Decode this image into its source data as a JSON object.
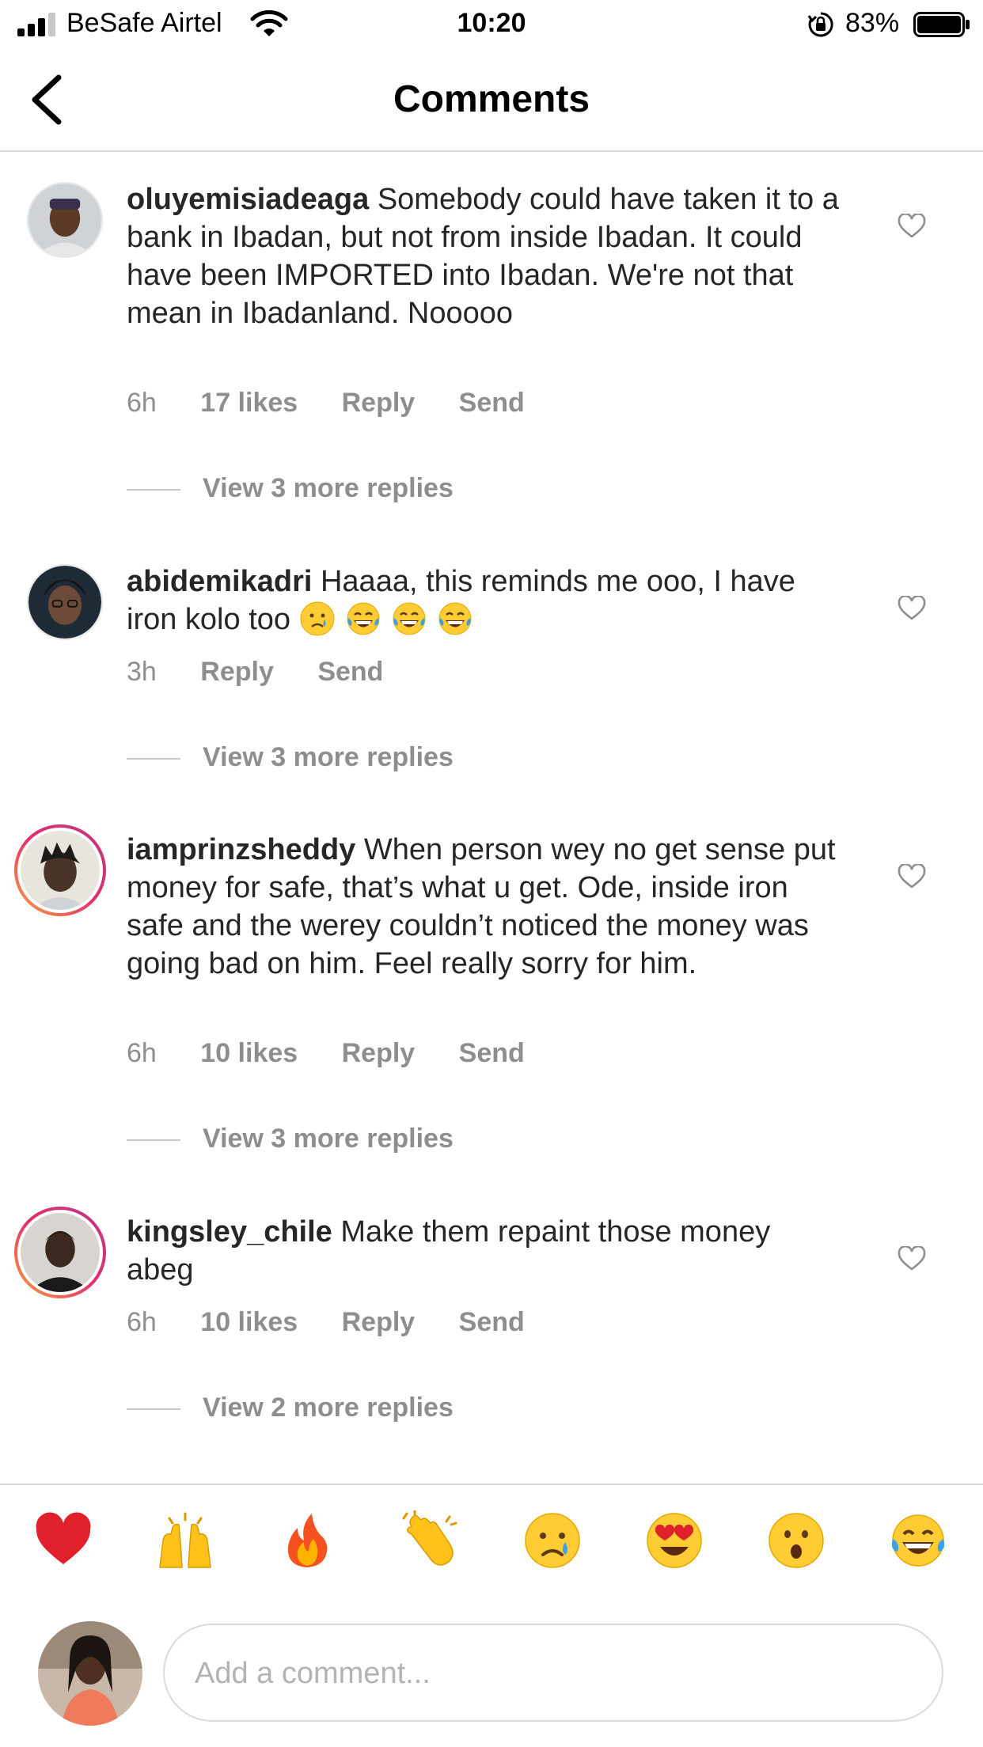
{
  "status_bar": {
    "carrier": "BeSafe Airtel",
    "time": "10:20",
    "battery_percent": "83%",
    "battery_level": 0.83
  },
  "header": {
    "title": "Comments"
  },
  "comments": [
    {
      "username": "oluyemisiadeaga",
      "text": "Somebody could have taken it to a bank in Ibadan, but not from inside Ibadan. It could have been IMPORTED into Ibadan. We're not that mean in Ibadanland. Nooooo",
      "time": "6h",
      "likes": "17 likes",
      "reply_label": "Reply",
      "send_label": "Send",
      "view_replies": "View 3 more replies"
    },
    {
      "username": "abidemikadri",
      "text": "Haaaa, this reminds me ooo, I have iron kolo too",
      "emojis": [
        "crying-face",
        "tears-of-joy",
        "tears-of-joy",
        "tears-of-joy"
      ],
      "time": "3h",
      "reply_label": "Reply",
      "send_label": "Send",
      "view_replies": "View 3 more replies"
    },
    {
      "username": "iamprinzsheddy",
      "text": "When person wey no get sense put money for safe, that’s what u get. Ode, inside iron safe and the werey couldn’t noticed the money was going bad on him. Feel really sorry for him.",
      "time": "6h",
      "likes": "10 likes",
      "reply_label": "Reply",
      "send_label": "Send",
      "view_replies": "View 3 more replies"
    },
    {
      "username": "kingsley_chile",
      "text": "Make them repaint those money abeg",
      "time": "6h",
      "likes": "10 likes",
      "reply_label": "Reply",
      "send_label": "Send",
      "view_replies": "View 2 more replies"
    }
  ],
  "emoji_bar": [
    "red-heart",
    "raising-hands",
    "fire",
    "clapping-hands",
    "crying-face",
    "heart-eyes",
    "surprised-face",
    "tears-of-joy"
  ],
  "composer": {
    "placeholder": "Add a comment..."
  }
}
